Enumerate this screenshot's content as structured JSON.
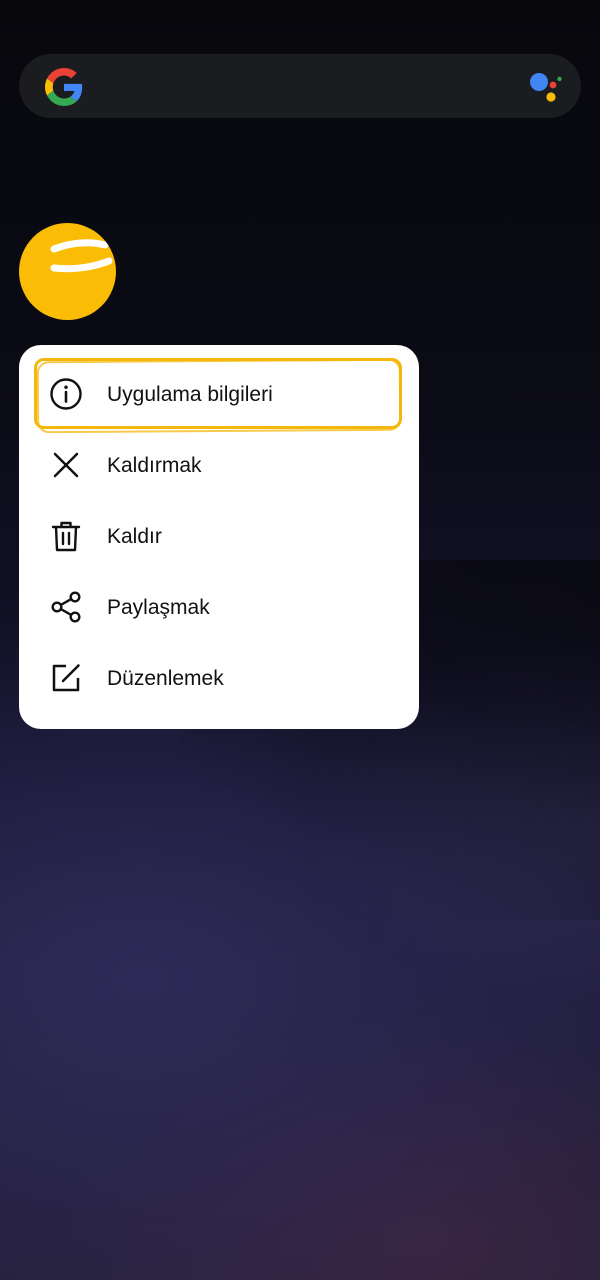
{
  "search_bar": {
    "google_icon": "google-g-logo",
    "assistant_icon": "google-assistant-icon"
  },
  "app_icon": {
    "icon": "app-yellow-circle-logo",
    "color": "#fbbc05"
  },
  "context_menu": {
    "highlight_color": "#f4b80c",
    "items": [
      {
        "label": "Uygulama bilgileri",
        "icon": "info-icon"
      },
      {
        "label": "Kaldırmak",
        "icon": "close-icon"
      },
      {
        "label": "Kaldır",
        "icon": "trash-icon"
      },
      {
        "label": "Paylaşmak",
        "icon": "share-icon"
      },
      {
        "label": "Düzenlemek",
        "icon": "edit-icon"
      }
    ]
  }
}
